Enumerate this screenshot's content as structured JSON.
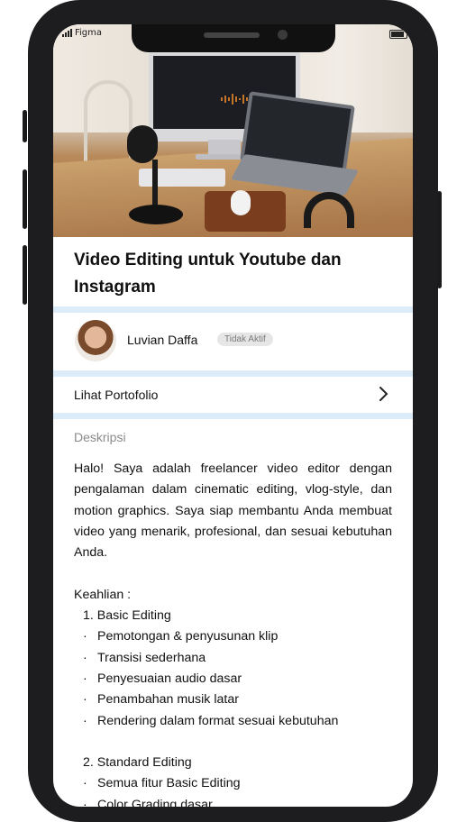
{
  "status_bar": {
    "carrier": "Figma"
  },
  "hero": {
    "icon": "video-editing-setup-image"
  },
  "title": "Video Editing untuk Youtube dan Instagram",
  "profile": {
    "name": "Luvian Daffa",
    "status": "Tidak Aktif"
  },
  "portfolio": {
    "label": "Lihat Portofolio"
  },
  "description": {
    "label": "Deskripsi",
    "intro": "Halo! Saya adalah freelancer video editor dengan pengalaman dalam cinematic editing, vlog-style, dan motion graphics. Saya siap membantu Anda membuat video yang menarik, profesional, dan sesuai kebutuhan Anda.",
    "skills_heading": "Keahlian :",
    "packages": [
      {
        "title": "1. Basic Editing",
        "items": [
          "Pemotongan & penyusunan klip",
          "Transisi sederhana",
          "Penyesuaian audio dasar",
          "Penambahan musik latar",
          "Rendering dalam format sesuai kebutuhan"
        ]
      },
      {
        "title": "2. Standard Editing",
        "items": [
          "Semua fitur Basic Editing",
          "Color Grading dasar"
        ]
      }
    ]
  },
  "colors": {
    "separator": "#dcecf9",
    "badge_bg": "#e6e6e6",
    "frame": "#1d1d1f"
  }
}
